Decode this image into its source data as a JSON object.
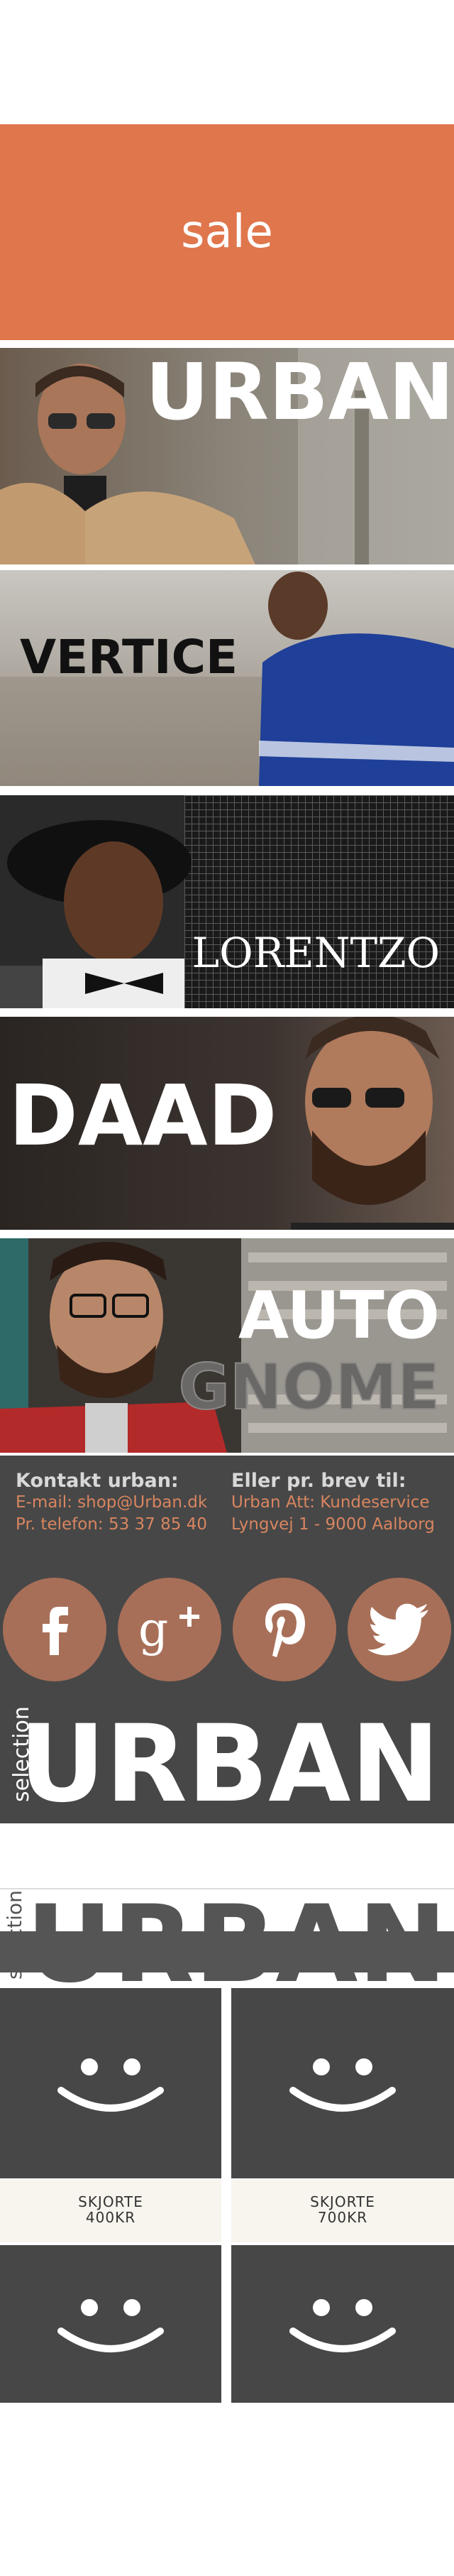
{
  "sale": {
    "label": "sale"
  },
  "brands": [
    {
      "name": "URBAN"
    },
    {
      "name": "VERTICE"
    },
    {
      "name": "LORENTZO"
    },
    {
      "name": "DAAD"
    },
    {
      "name": "AUTO",
      "name2": "GNOME"
    }
  ],
  "contact": {
    "left_heading": "Kontakt urban:",
    "left_line1": "E-mail: shop@Urban.dk",
    "left_line2": "Pr. telefon: 53 37 85 40",
    "right_heading": "Eller pr. brev til:",
    "right_line1": "Urban Att: Kundeservice",
    "right_line2": "Lyngvej 1 - 9000 Aalborg"
  },
  "social": [
    "facebook-icon",
    "google-plus-icon",
    "pinterest-icon",
    "twitter-icon"
  ],
  "logo": {
    "small": "selection",
    "big": "URBAN"
  },
  "products": [
    {
      "name": "SKJORTE",
      "price": "400KR"
    },
    {
      "name": "SKJORTE",
      "price": "700KR"
    }
  ],
  "colors": {
    "sale": "#e0764c",
    "dark": "#474747",
    "accent": "#d88560",
    "social": "#a86f58"
  }
}
